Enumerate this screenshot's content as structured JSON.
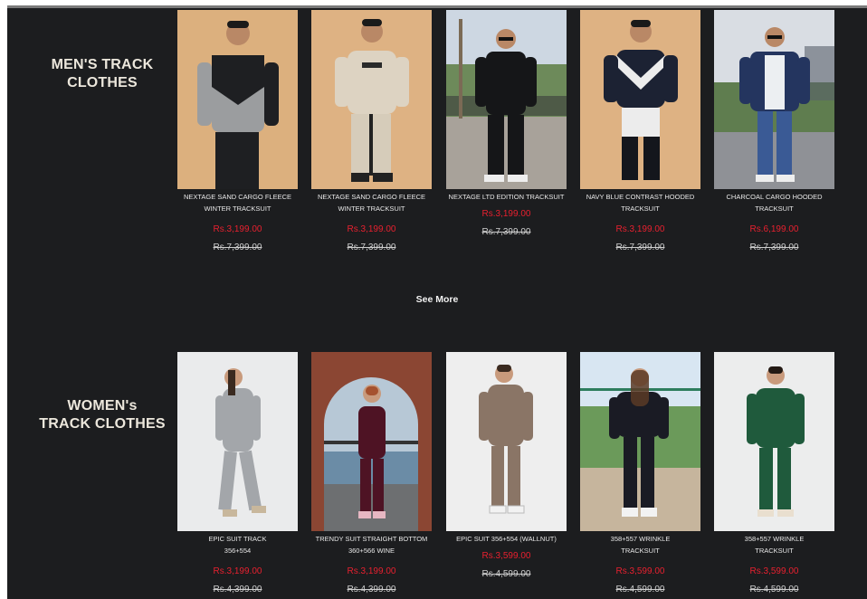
{
  "sections": [
    {
      "title_line1": "MEN'S TRACK",
      "title_line2": "CLOTHES",
      "products": [
        {
          "name_line1": "NEXTAGE SAND CARGO FLEECE",
          "name_line2": "WINTER TRACKSUIT",
          "price": "Rs.3,199.00",
          "old_price": "Rs.7,399.00"
        },
        {
          "name_line1": "NEXTAGE SAND CARGO FLEECE",
          "name_line2": "WINTER TRACKSUIT",
          "price": "Rs.3,199.00",
          "old_price": "Rs.7,399.00"
        },
        {
          "name_line1": "NEXTAGE LTD EDITION TRACKSUIT",
          "name_line2": "",
          "price": "Rs.3,199.00",
          "old_price": "Rs.7,399.00"
        },
        {
          "name_line1": "NAVY BLUE CONTRAST HOODED",
          "name_line2": "TRACKSUIT",
          "price": "Rs.3,199.00",
          "old_price": "Rs.7,399.00"
        },
        {
          "name_line1": "CHARCOAL CARGO HOODED",
          "name_line2": "TRACKSUIT",
          "price": "Rs.6,199.00",
          "old_price": "Rs.7,399.00"
        }
      ],
      "see_more": "See More"
    },
    {
      "title_line1": "WOMEN's",
      "title_line2": "TRACK CLOTHES",
      "products": [
        {
          "name_line1": "EPIC SUIT TRACK",
          "name_line2": "356+554",
          "price": "Rs.3,199.00",
          "old_price": "Rs.4,399.00"
        },
        {
          "name_line1": "TRENDY SUIT STRAIGHT BOTTOM",
          "name_line2": "360+566 WINE",
          "price": "Rs.3,199.00",
          "old_price": "Rs.4,399.00"
        },
        {
          "name_line1": "EPIC SUIT 356+554 (WALLNUT)",
          "name_line2": "",
          "price": "Rs.3,599.00",
          "old_price": "Rs.4,599.00"
        },
        {
          "name_line1": "358+557 WRINKLE",
          "name_line2": "TRACKSUIT",
          "price": "Rs.3,599.00",
          "old_price": "Rs.4,599.00"
        },
        {
          "name_line1": "358+557 WRINKLE",
          "name_line2": "TRACKSUIT",
          "price": "Rs.3,599.00",
          "old_price": "Rs.4,599.00"
        }
      ]
    }
  ],
  "colors": {
    "background": "#1c1d1f",
    "price": "#e8202f",
    "text": "#e8e8e8"
  }
}
